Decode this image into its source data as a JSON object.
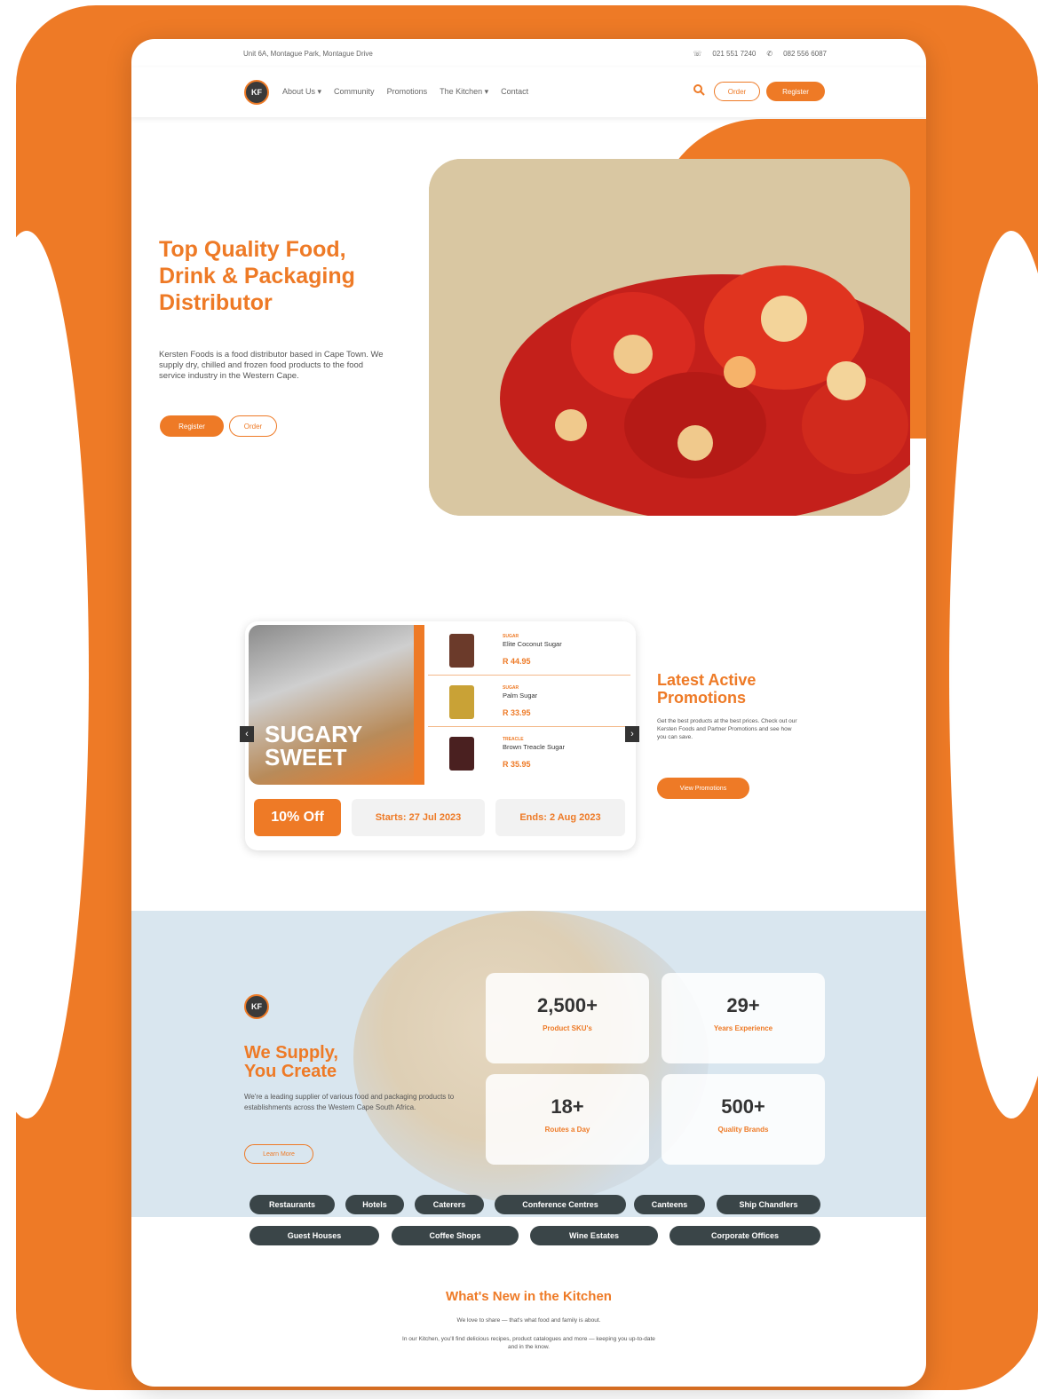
{
  "colors": {
    "accent": "#EE7A26",
    "dark_pill": "#3a4548"
  },
  "topbar": {
    "address": "Unit 6A, Montague Park, Montague Drive",
    "phone": "021 551 7240",
    "whatsapp": "082 556 6087"
  },
  "nav": {
    "logo_text": "KF",
    "links": [
      "About Us ▾",
      "Community",
      "Promotions",
      "The Kitchen ▾",
      "Contact"
    ],
    "order_label": "Order",
    "register_label": "Register"
  },
  "hero": {
    "title": "Top Quality Food, Drink & Packaging Distributor",
    "description": "Kersten Foods is a food distributor based in Cape Town. We supply dry, chilled and frozen food products to the food service industry in the Western Cape.",
    "register_label": "Register",
    "order_label": "Order"
  },
  "promo": {
    "banner_title_1": "SUGARY",
    "banner_title_2": "SWEET",
    "items": [
      {
        "category": "SUGAR",
        "name": "Elite Coconut Sugar",
        "price": "R 44.95"
      },
      {
        "category": "SUGAR",
        "name": "Palm Sugar",
        "price": "R 33.95"
      },
      {
        "category": "TREACLE",
        "name": "Brown Treacle Sugar",
        "price": "R 35.95"
      }
    ],
    "discount": "10% Off",
    "starts": "Starts: 27 Jul 2023",
    "ends": "Ends: 2 Aug 2023"
  },
  "latest": {
    "title_1": "Latest Active",
    "title_2": "Promotions",
    "description": "Get the best products at the best prices. Check out our Kersten Foods and Partner Promotions and see how you can save.",
    "button_label": "View Promotions"
  },
  "supply": {
    "logo_text": "KF",
    "title_1": "We Supply,",
    "title_2": "You Create",
    "description": "We're a leading supplier of various food and packaging products to establishments across the Western Cape South Africa.",
    "button_label": "Learn More",
    "stats": [
      {
        "number": "2,500+",
        "label": "Product SKU's"
      },
      {
        "number": "29+",
        "label": "Years Experience"
      },
      {
        "number": "18+",
        "label": "Routes a Day"
      },
      {
        "number": "500+",
        "label": "Quality Brands"
      }
    ]
  },
  "segments_row1": [
    "Restaurants",
    "Hotels",
    "Caterers",
    "Conference Centres",
    "Canteens",
    "Ship Chandlers"
  ],
  "segments_row2": [
    "Guest Houses",
    "Coffee Shops",
    "Wine Estates",
    "Corporate Offices"
  ],
  "kitchen": {
    "title": "What's New in the Kitchen",
    "subtitle": "We love to share — that's what food and family is about.",
    "text": "In our Kitchen, you'll find delicious recipes, product catalogues and more — keeping you up-to-date and in the know."
  }
}
